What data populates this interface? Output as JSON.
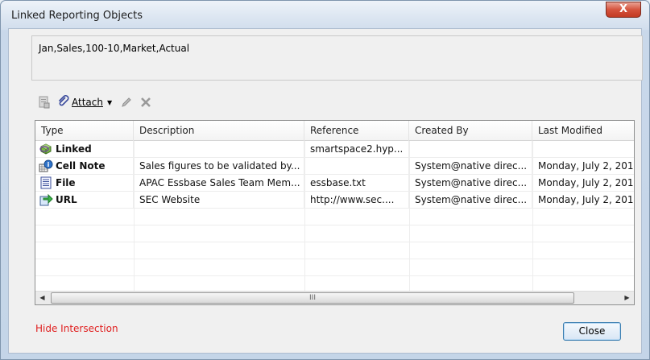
{
  "window": {
    "title": "Linked Reporting Objects",
    "close_glyph": "X"
  },
  "intersection_text": "Jan,Sales,100-10,Market,Actual",
  "toolbar": {
    "attach_label": "Attach",
    "icons": [
      "view-icon",
      "paperclip-icon",
      "pencil-icon",
      "delete-x-icon"
    ]
  },
  "table": {
    "columns": [
      "Type",
      "Description",
      "Reference",
      "Created By",
      "Last Modified"
    ],
    "rows": [
      {
        "type": "Linked",
        "icon": "linked-cube-icon",
        "description": "",
        "reference": "smartspace2.hyp...",
        "created_by": "",
        "last_modified": ""
      },
      {
        "type": "Cell Note",
        "icon": "cell-note-icon",
        "description": "Sales figures to be validated by...",
        "reference": "",
        "created_by": "System@native direc...",
        "last_modified": "Monday, July 2, 201"
      },
      {
        "type": "File",
        "icon": "file-icon",
        "description": "APAC Essbase Sales Team Mem...",
        "reference": "essbase.txt",
        "created_by": "System@native direc...",
        "last_modified": "Monday, July 2, 201"
      },
      {
        "type": "URL",
        "icon": "url-arrow-icon",
        "description": "SEC Website",
        "reference": "http://www.sec....",
        "created_by": "System@native direc...",
        "last_modified": "Monday, July 2, 201"
      }
    ],
    "scroll_thumb_grip": "III"
  },
  "hide_intersection_label": "Hide Intersection",
  "close_button_label": "Close",
  "colors": {
    "link_red": "#e01e1e",
    "title_close": "#c9432c"
  }
}
